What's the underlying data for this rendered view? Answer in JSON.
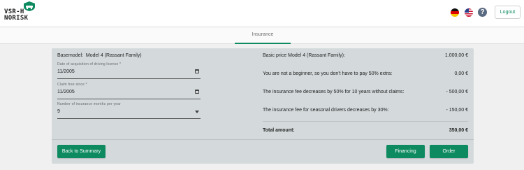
{
  "header": {
    "logo_text_line1": "VSR-H",
    "logo_text_line2": "NORISK",
    "language_flags": [
      "flag-germany-icon",
      "flag-us-icon"
    ],
    "help_icon": "?",
    "logout_label": "Logout"
  },
  "tabs": [
    {
      "label": "Insurance",
      "active": true
    }
  ],
  "colors": {
    "accent": "#0d8a5f",
    "card_bg": "#d4dadc",
    "page_bg": "#f0f0f0"
  },
  "form": {
    "basemodel_label": "Basemodel:",
    "basemodel_value": "Model 4 (Rassant Family)",
    "fields": [
      {
        "label": "Date of acquisition of driving license *",
        "value": "11/2005",
        "icon": "calendar-icon"
      },
      {
        "label": "Claim free since *",
        "value": "11/2005",
        "icon": "calendar-icon"
      },
      {
        "label": "Number of insurance months per year",
        "value": "9",
        "icon": "chevron-down-icon"
      }
    ]
  },
  "summary": {
    "rows": [
      {
        "label": "Basic price Model 4 (Rassant Family):",
        "value": "1.000,00 €"
      },
      {
        "label": "You are not a beginner, so you don't have to pay 50% extra:",
        "value": "0,00 €"
      },
      {
        "label": "The insurance fee decreases by 50% for 10 years without claims:",
        "value": "- 500,00 €"
      },
      {
        "label": "The insurance fee for seasonal drivers decreases by 30%:",
        "value": "- 150,00 €"
      }
    ],
    "total_label": "Total amount:",
    "total_value": "350,00 €"
  },
  "actions": {
    "back_label": "Back to Summary",
    "financing_label": "Financing",
    "order_label": "Order"
  }
}
